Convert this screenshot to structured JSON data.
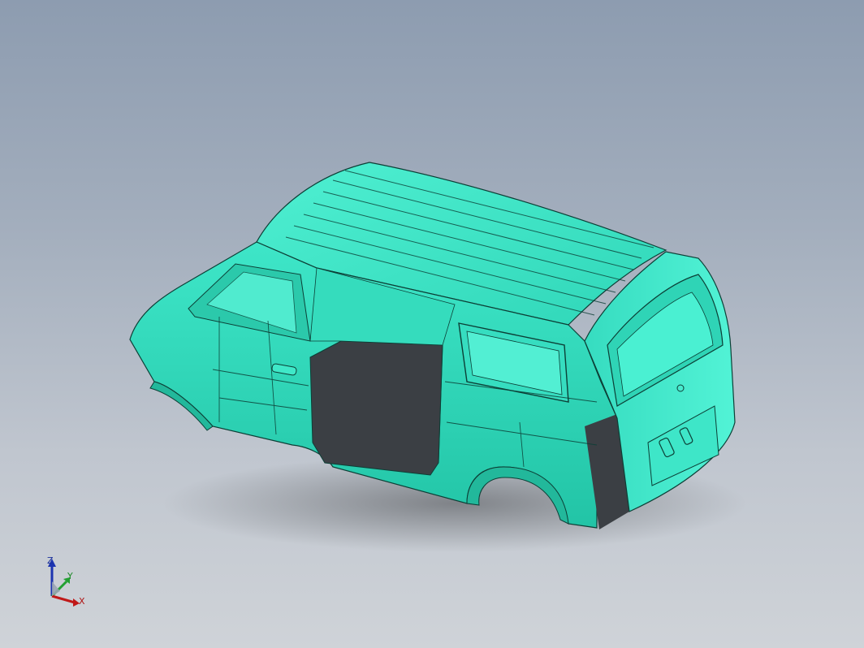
{
  "viewport": {
    "background_top": "#8d9cb0",
    "background_bottom": "#cfd3d8",
    "model_color": "#3fe8c8",
    "model_edge_color": "#0c3f36",
    "interior_color": "#3b3f44"
  },
  "model": {
    "name": "van-body-in-white"
  },
  "triad": {
    "x_label": "X",
    "y_label": "Y",
    "z_label": "Z",
    "x_color": "#c01818",
    "y_color": "#22a032",
    "z_color": "#1c34b0"
  }
}
